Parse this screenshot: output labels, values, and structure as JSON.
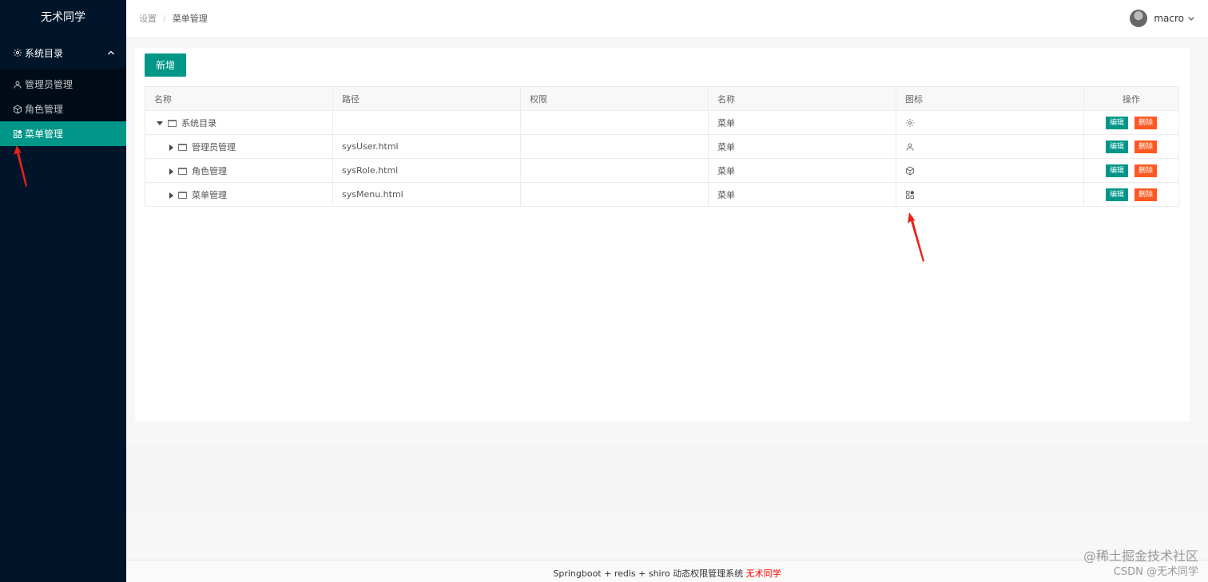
{
  "sidebar": {
    "logo": "无术同学",
    "group": {
      "label": "系统目录",
      "icon": "gear-icon"
    },
    "items": [
      {
        "label": "管理员管理",
        "icon": "user-icon",
        "active": false
      },
      {
        "label": "角色管理",
        "icon": "cube-icon",
        "active": false
      },
      {
        "label": "菜单管理",
        "icon": "apps-icon",
        "active": true
      }
    ]
  },
  "header": {
    "breadcrumb": [
      "设置",
      "菜单管理"
    ],
    "separator": "/",
    "user_name": "macro"
  },
  "toolbar": {
    "add_label": "新增"
  },
  "table": {
    "columns": [
      "名称",
      "路径",
      "权限",
      "名称",
      "图标",
      "操作"
    ],
    "rows": [
      {
        "name": "系统目录",
        "path": "",
        "perm": "",
        "type": "菜单",
        "icon": "gear-icon",
        "expanded": true,
        "level": 0
      },
      {
        "name": "管理员管理",
        "path": "sysUser.html",
        "perm": "",
        "type": "菜单",
        "icon": "user-icon",
        "expanded": false,
        "level": 1
      },
      {
        "name": "角色管理",
        "path": "sysRole.html",
        "perm": "",
        "type": "菜单",
        "icon": "cube-icon",
        "expanded": false,
        "level": 1
      },
      {
        "name": "菜单管理",
        "path": "sysMenu.html",
        "perm": "",
        "type": "菜单",
        "icon": "apps-icon",
        "expanded": false,
        "level": 1
      }
    ],
    "edit_label": "编辑",
    "delete_label": "删除"
  },
  "footer": {
    "text": "Springboot + redis + shiro 动态权限管理系统",
    "author": "无术同学"
  },
  "watermark": {
    "line1": "@稀土掘金技术社区",
    "line2": "CSDN @无术同学"
  },
  "colors": {
    "sidebar_bg": "#001529",
    "accent": "#009688",
    "danger": "#ff5722",
    "annotation_arrow": "#e8231b"
  }
}
